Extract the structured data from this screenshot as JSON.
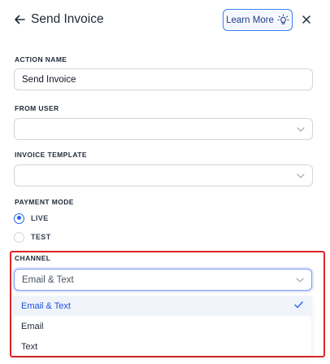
{
  "header": {
    "title": "Send Invoice",
    "learn_more": "Learn More"
  },
  "action_name": {
    "label": "ACTION NAME",
    "value": "Send Invoice"
  },
  "from_user": {
    "label": "FROM USER",
    "value": ""
  },
  "invoice_template": {
    "label": "INVOICE TEMPLATE",
    "value": ""
  },
  "payment_mode": {
    "label": "PAYMENT MODE",
    "options": [
      {
        "label": "LIVE",
        "checked": true
      },
      {
        "label": "TEST",
        "checked": false
      }
    ]
  },
  "channel": {
    "label": "CHANNEL",
    "selected": "Email & Text",
    "options": [
      {
        "label": "Email & Text",
        "selected": true
      },
      {
        "label": "Email",
        "selected": false
      },
      {
        "label": "Text",
        "selected": false
      }
    ]
  },
  "colors": {
    "accent": "#2563eb",
    "highlight_border": "#dc2626",
    "selected_option_bg": "#f0f4fa"
  }
}
